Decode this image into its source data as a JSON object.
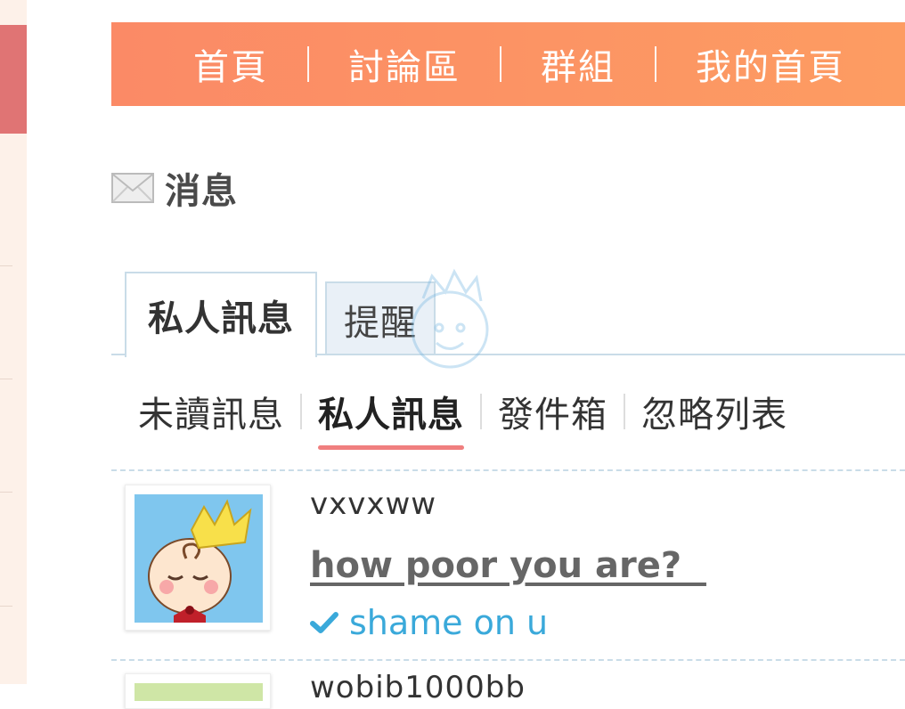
{
  "nav": {
    "items": [
      "首頁",
      "討論區",
      "群組",
      "我的首頁"
    ]
  },
  "page": {
    "title": "消息",
    "title_icon": "envelope-icon"
  },
  "tabs": [
    {
      "label": "私人訊息",
      "active": true
    },
    {
      "label": "提醒",
      "active": false
    }
  ],
  "subtabs": [
    {
      "label": "未讀訊息",
      "active": false
    },
    {
      "label": "私人訊息",
      "active": true
    },
    {
      "label": "發件箱",
      "active": false
    },
    {
      "label": "忽略列表",
      "active": false
    }
  ],
  "messages": [
    {
      "sender": "vxvxww",
      "subject": "how poor you are?  ",
      "status": "shame on u",
      "status_icon": "check-icon",
      "avatar": "baby-king-avatar"
    },
    {
      "sender": "wobib1000bb",
      "avatar": "avatar"
    }
  ],
  "colors": {
    "nav_bg": "#fd9362",
    "accent": "#f07f7f",
    "link_blue": "#3aa9da",
    "tab_border": "#c9dce8"
  }
}
